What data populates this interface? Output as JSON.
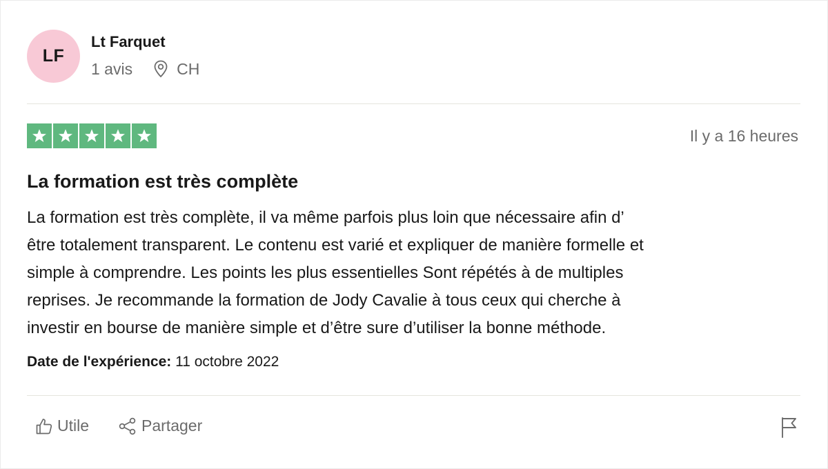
{
  "reviewer": {
    "initials": "LF",
    "name": "Lt Farquet",
    "review_count": "1 avis",
    "country": "CH",
    "avatar_color": "#f8c9d6"
  },
  "review": {
    "rating": 5,
    "rating_max": 5,
    "star_color": "#5fb87f",
    "time_ago": "Il y a 16 heures",
    "title": "La formation est très complète",
    "body_lines": [
      "La formation est très complète, il va même parfois plus loin que nécessaire afin d’",
      "être totalement transparent. Le contenu est varié et expliquer de manière formelle et",
      "simple à comprendre. Les points les plus essentielles Sont répétés à de multiples",
      "reprises. Je recommande la formation de Jody Cavalie à tous ceux qui cherche à",
      "investir en bourse de manière simple et d’être sure d’utiliser la bonne méthode."
    ],
    "experience_label": "Date de l'expérience:",
    "experience_date": "11 octobre 2022"
  },
  "actions": {
    "useful_label": "Utile",
    "useful_icon": "thumbs-up-icon",
    "share_label": "Partager",
    "share_icon": "share-icon",
    "report_icon": "flag-icon"
  }
}
